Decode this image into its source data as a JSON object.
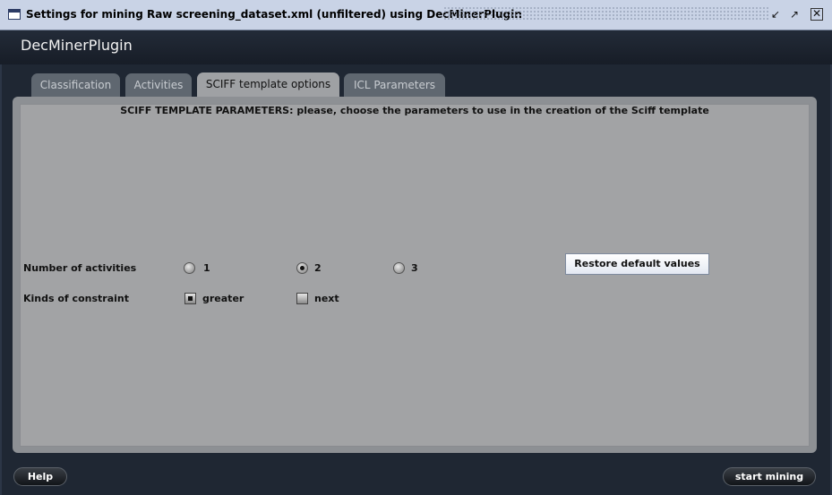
{
  "window": {
    "title": "Settings for mining Raw screening_dataset.xml (unfiltered) using DecMinerPlugin"
  },
  "app": {
    "title": "DecMinerPlugin"
  },
  "tabs": [
    {
      "label": "Classification",
      "active": false
    },
    {
      "label": "Activities",
      "active": false
    },
    {
      "label": "SCIFF template options",
      "active": true
    },
    {
      "label": "ICL Parameters",
      "active": false
    }
  ],
  "panel": {
    "heading": "SCIFF TEMPLATE PARAMETERS: please, choose the parameters to use in the creation of the Sciff template",
    "activities": {
      "label": "Number of activities",
      "options": [
        {
          "label": "1",
          "selected": false
        },
        {
          "label": "2",
          "selected": true
        },
        {
          "label": "3",
          "selected": false
        }
      ]
    },
    "constraints": {
      "label": "Kinds of constraint",
      "options": [
        {
          "label": "greater",
          "checked": true
        },
        {
          "label": "next",
          "checked": false
        }
      ]
    },
    "restore_label": "Restore default values"
  },
  "footer": {
    "help_label": "Help",
    "start_label": "start mining"
  },
  "colors": {
    "header_bg": "#1f2733",
    "panel_bg": "#a2a3a5",
    "titlebar_bg": "#c9d3e6"
  }
}
